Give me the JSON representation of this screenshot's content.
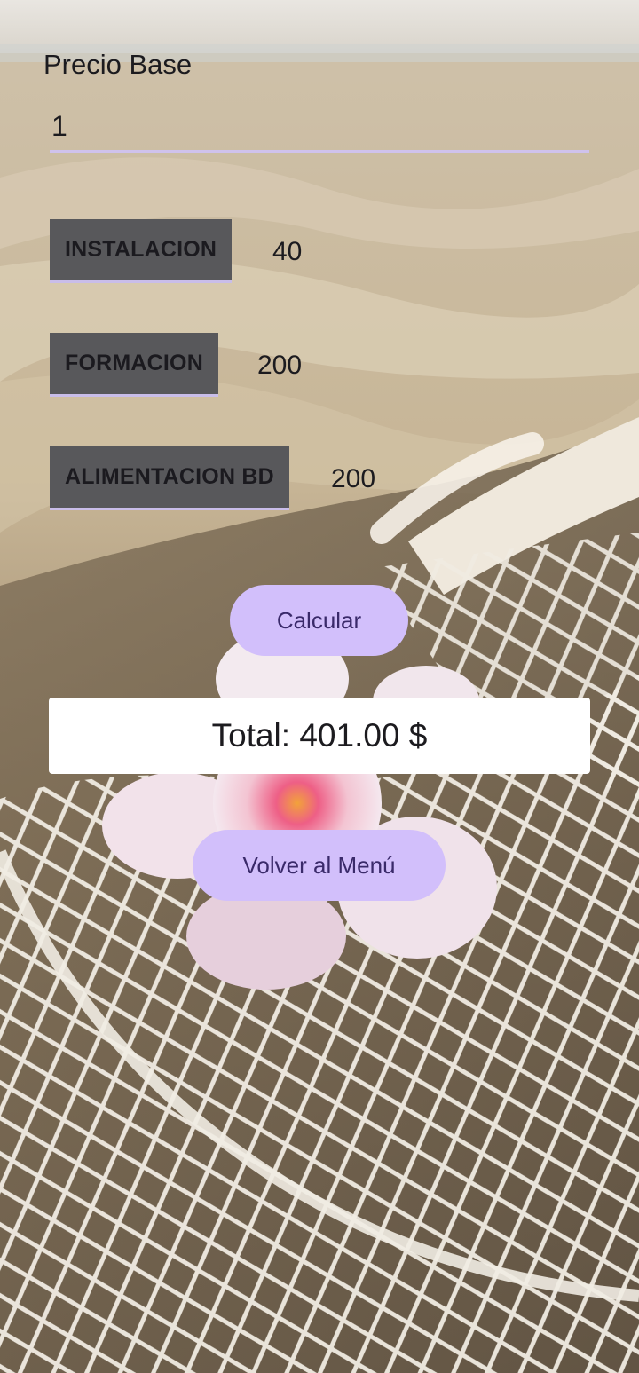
{
  "precio_base": {
    "label": "Precio Base",
    "value": "1"
  },
  "options": [
    {
      "label": "INSTALACION",
      "value": "40"
    },
    {
      "label": "FORMACION",
      "value": "200"
    },
    {
      "label": "ALIMENTACION BD",
      "value": "200"
    }
  ],
  "calcular_label": "Calcular",
  "total_text": "Total: 401.00 $",
  "volver_label": "Volver al Menú",
  "colors": {
    "button_gray": "#58585b",
    "accent_purple": "#d2bffb",
    "underline": "#cfc2ec",
    "text_dark": "#1c1b1f"
  }
}
